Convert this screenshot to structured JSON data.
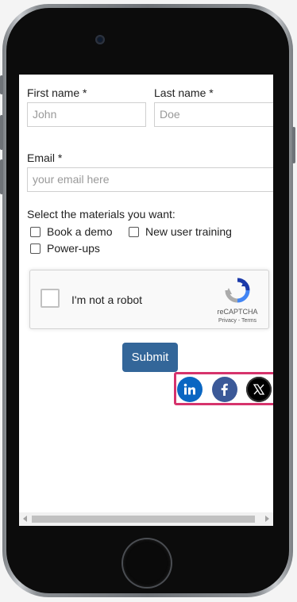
{
  "form": {
    "first_name_label": "First name *",
    "first_name_placeholder": "John",
    "last_name_label": "Last name *",
    "last_name_placeholder": "Doe",
    "email_label": "Email *",
    "email_placeholder": "your email here",
    "materials_label": "Select the materials you want:",
    "materials_options": [
      "Book a demo",
      "New user training",
      "Power-ups"
    ],
    "submit_label": "Submit"
  },
  "recaptcha": {
    "label": "I'm not a robot",
    "brand": "reCAPTCHA",
    "links": "Privacy - Terms"
  },
  "social": {
    "icons": [
      "linkedin-icon",
      "facebook-icon",
      "x-icon"
    ],
    "colors": {
      "linkedin": "#0a66c2",
      "facebook": "#3b5998",
      "x": "#000000",
      "highlight": "#d6336c",
      "submit": "#336699"
    }
  }
}
